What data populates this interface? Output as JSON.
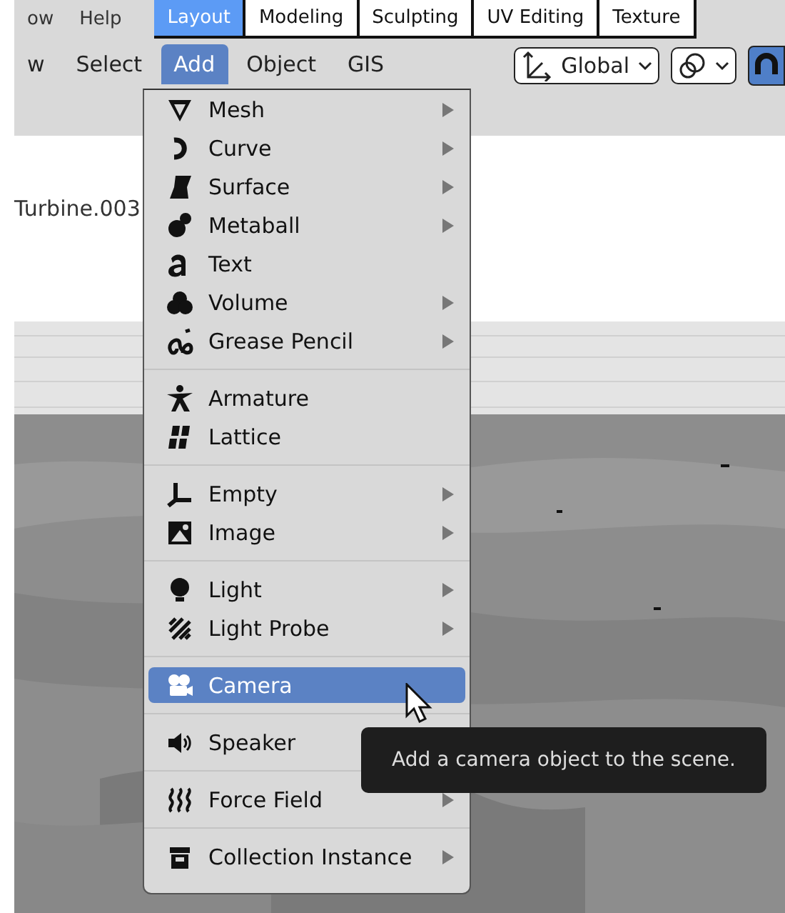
{
  "top_bar": {
    "menus": [
      "ow",
      "Help"
    ],
    "workspace_tabs": [
      {
        "label": "Layout",
        "selected": true
      },
      {
        "label": "Modeling",
        "selected": false
      },
      {
        "label": "Sculpting",
        "selected": false
      },
      {
        "label": "UV Editing",
        "selected": false
      },
      {
        "label": "Texture",
        "selected": false
      }
    ]
  },
  "header_menus": [
    {
      "label": "w",
      "selected": false
    },
    {
      "label": "Select",
      "selected": false
    },
    {
      "label": "Add",
      "selected": true
    },
    {
      "label": "Object",
      "selected": false
    },
    {
      "label": "GIS",
      "selected": false
    }
  ],
  "orientation": {
    "value": "Global"
  },
  "snap": {
    "on": true
  },
  "viewport": {
    "object_label": "Turbine.003"
  },
  "add_menu": {
    "sections": [
      {
        "items": [
          {
            "label": "Mesh",
            "submenu": true,
            "selected": false
          },
          {
            "label": "Curve",
            "submenu": true,
            "selected": false
          },
          {
            "label": "Surface",
            "submenu": true,
            "selected": false
          },
          {
            "label": "Metaball",
            "submenu": true,
            "selected": false
          },
          {
            "label": "Text",
            "submenu": false,
            "selected": false
          },
          {
            "label": "Volume",
            "submenu": true,
            "selected": false
          },
          {
            "label": "Grease Pencil",
            "submenu": true,
            "selected": false
          }
        ]
      },
      {
        "items": [
          {
            "label": "Armature",
            "submenu": false,
            "selected": false
          },
          {
            "label": "Lattice",
            "submenu": false,
            "selected": false
          }
        ]
      },
      {
        "items": [
          {
            "label": "Empty",
            "submenu": true,
            "selected": false
          },
          {
            "label": "Image",
            "submenu": true,
            "selected": false
          }
        ]
      },
      {
        "items": [
          {
            "label": "Light",
            "submenu": true,
            "selected": false
          },
          {
            "label": "Light Probe",
            "submenu": true,
            "selected": false
          }
        ]
      },
      {
        "items": [
          {
            "label": "Camera",
            "submenu": false,
            "selected": true
          }
        ]
      },
      {
        "items": [
          {
            "label": "Speaker",
            "submenu": false,
            "selected": false
          }
        ]
      },
      {
        "items": [
          {
            "label": "Force Field",
            "submenu": true,
            "selected": false
          }
        ]
      },
      {
        "items": [
          {
            "label": "Collection Instance",
            "submenu": true,
            "selected": false
          }
        ]
      }
    ]
  },
  "tooltip": {
    "text": "Add a camera object to the scene."
  }
}
